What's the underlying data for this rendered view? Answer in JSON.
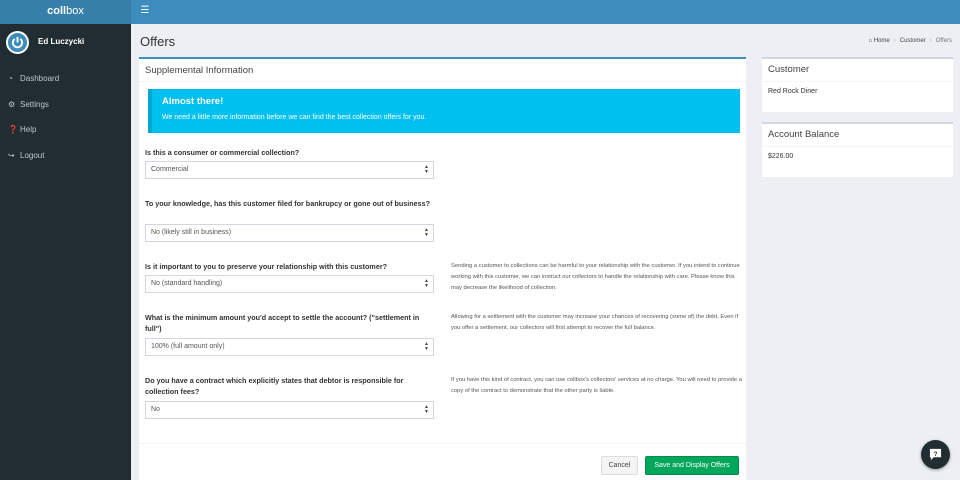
{
  "brand": {
    "part1": "coll",
    "part2": "box"
  },
  "user": {
    "name": "Ed Luczycki"
  },
  "sidebar": {
    "items": [
      {
        "label": "Dashboard",
        "icon": "dashboard-icon"
      },
      {
        "label": "Settings",
        "icon": "gear-icon"
      },
      {
        "label": "Help",
        "icon": "question-circle-icon"
      },
      {
        "label": "Logout",
        "icon": "sign-out-icon"
      }
    ]
  },
  "page": {
    "title": "Offers"
  },
  "breadcrumb": {
    "home": "Home",
    "customer": "Customer",
    "current": "Offers"
  },
  "form": {
    "title": "Supplemental Information",
    "callout": {
      "title": "Almost there!",
      "text": "We need a little more information before we can find the best collection offers for you."
    },
    "questions": [
      {
        "label": "Is this a consumer or commercial collection?",
        "value": "Commercial",
        "help": ""
      },
      {
        "label": "To your knowledge, has this customer filed for bankrupcy or gone out of business?",
        "value": "No (likely still in business)",
        "help": ""
      },
      {
        "label": "Is it important to you to preserve your relationship with this customer?",
        "value": "No (standard handling)",
        "help": "Sending a customer to collections can be harmful to your relationship with the customer. If you intend to continue working with this customer, we can instruct our collectors to handle the relationship with care. Please know this may decrease the likelihood of collection."
      },
      {
        "label": "What is the minimum amount you'd accept to settle the account? (\"settlement in full\")",
        "value": "100% (full amount only)",
        "help": "Allowing for a settlement with the customer may increase your chances of recovering (some of) the debt. Even if you offer a settlement, our collectors will first attempt to recover the full balance."
      },
      {
        "label": "Do you have a contract which explicitly states that debtor is responsible for collection fees?",
        "value": "No",
        "help": "If you have this kind of contract, you can use collbox's collectors' services at no charge. You will need to provide a copy of the contract to demonstrate that the other party is liable."
      }
    ],
    "cancel_label": "Cancel",
    "submit_label": "Save and Display Offers"
  },
  "customer_box": {
    "title": "Customer",
    "name": "Red Rock Diner"
  },
  "balance_box": {
    "title": "Account Balance",
    "amount": "$226.00"
  },
  "colors": {
    "header": "#3c8dbc",
    "logo_bg": "#367fa9",
    "sidebar": "#222d32",
    "callout": "#00c0ef",
    "save": "#00a65a"
  }
}
